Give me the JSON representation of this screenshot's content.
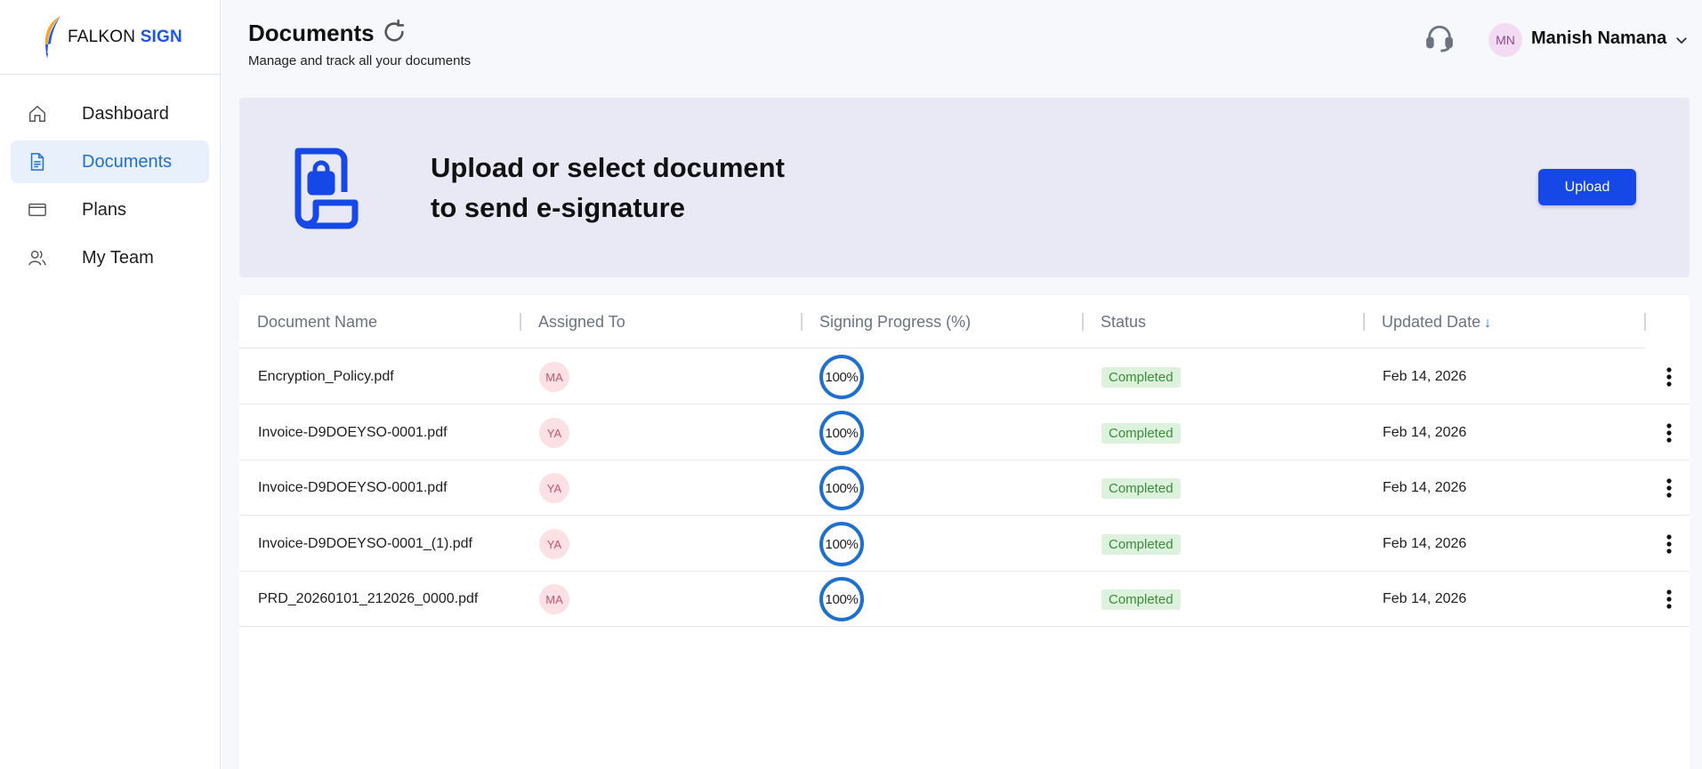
{
  "brand": {
    "name_part1": "FALKON",
    "name_part2": "SIGN"
  },
  "sidebar": {
    "items": [
      {
        "label": "Dashboard",
        "icon": "home-icon",
        "active": false
      },
      {
        "label": "Documents",
        "icon": "document-icon",
        "active": true
      },
      {
        "label": "Plans",
        "icon": "card-icon",
        "active": false
      },
      {
        "label": "My Team",
        "icon": "team-icon",
        "active": false
      }
    ]
  },
  "header": {
    "title": "Documents",
    "subtitle": "Manage and track all your documents",
    "user": {
      "initials": "MN",
      "name": "Manish Namana"
    }
  },
  "banner": {
    "text_line1": "Upload or select document",
    "text_line2": "to send e-signature",
    "button_label": "Upload"
  },
  "table": {
    "columns": [
      "Document Name",
      "Assigned To",
      "Signing Progress (%)",
      "Status",
      "Updated Date"
    ],
    "sort_arrow": "↓",
    "rows": [
      {
        "name": "Encryption_Policy.pdf",
        "assignee": "MA",
        "progress": "100%",
        "status": "Completed",
        "date": "Feb 14, 2026"
      },
      {
        "name": "Invoice-D9DOEYSO-0001.pdf",
        "assignee": "YA",
        "progress": "100%",
        "status": "Completed",
        "date": "Feb 14, 2026"
      },
      {
        "name": "Invoice-D9DOEYSO-0001.pdf",
        "assignee": "YA",
        "progress": "100%",
        "status": "Completed",
        "date": "Feb 14, 2026"
      },
      {
        "name": "Invoice-D9DOEYSO-0001_(1).pdf",
        "assignee": "YA",
        "progress": "100%",
        "status": "Completed",
        "date": "Feb 14, 2026"
      },
      {
        "name": "PRD_20260101_212026_0000.pdf",
        "assignee": "MA",
        "progress": "100%",
        "status": "Completed",
        "date": "Feb 14, 2026"
      }
    ]
  },
  "colors": {
    "accent": "#1648e8",
    "active_nav_bg": "#e7f0fb",
    "banner_bg": "#e9e9f5",
    "status_bg": "#dcf2dc",
    "status_text": "#3b8b3b",
    "progress_ring": "#1f6fcf"
  }
}
